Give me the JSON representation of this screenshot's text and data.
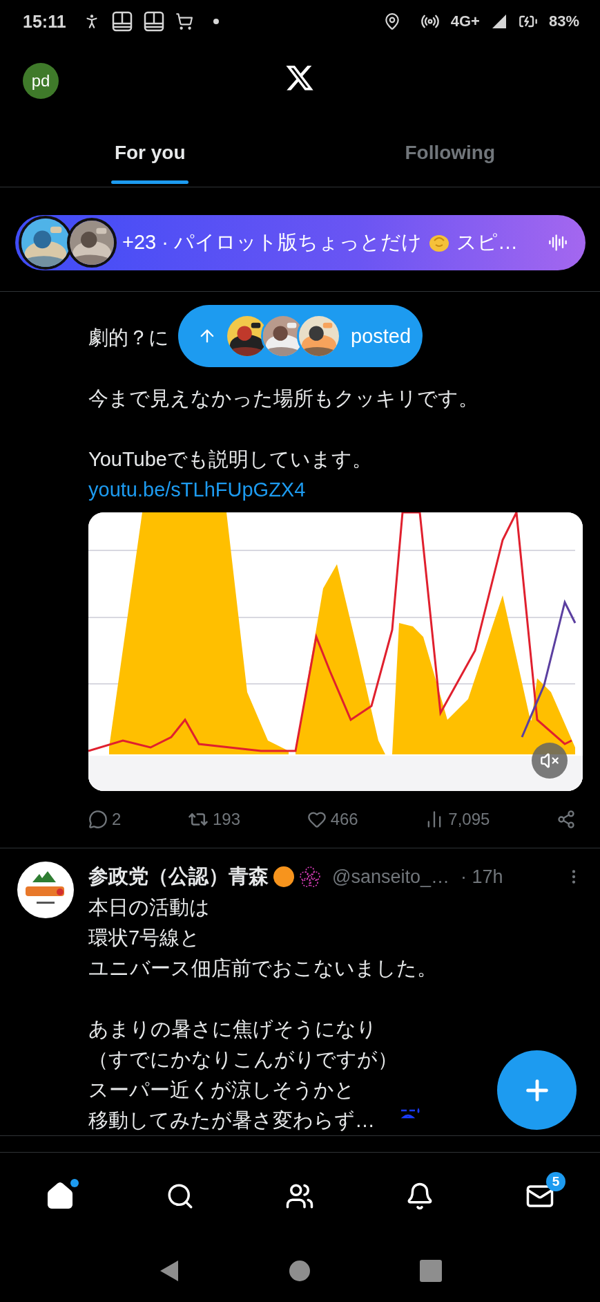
{
  "status_bar": {
    "time": "15:11",
    "network": "4G+",
    "battery": "83%"
  },
  "header": {
    "avatar": "pd"
  },
  "tabs": [
    {
      "label": "For you",
      "selected": true
    },
    {
      "label": "Following",
      "selected": false
    }
  ],
  "space_banner": {
    "text": "+23 · パイロット版ちょっとだけ",
    "text_end": "スピ…"
  },
  "posted_pill": {
    "label": "posted"
  },
  "tweets": [
    {
      "paragraphs": [
        [
          "劇的？に"
        ],
        [
          "今まで見えなかった場所もクッキリです。"
        ],
        [
          "YouTubeでも説明しています。"
        ]
      ],
      "link": "youtu.be/sTLhFUpGZX4",
      "media": {
        "kind": "picture",
        "muted": true
      },
      "stats": {
        "replies": "2",
        "reposts": "193",
        "likes": "466",
        "views": "7,095"
      }
    },
    {
      "author": {
        "name": "参政党（公認）青森",
        "handle": "@sanseito_…",
        "time": "· 17h"
      },
      "paragraphs": [
        [
          "本日の活動は",
          "環状7号線と",
          "ユニバース佃店前でおこないました。"
        ],
        [
          "あまりの暑さに焦げそうになり",
          "（すでにかなりこんがりですが）",
          "スーパー近くが涼しそうかと",
          "移動してみたが暑さ変わらず…"
        ]
      ]
    }
  ],
  "nav": [
    {
      "kind": "home",
      "selected": true,
      "dot": true
    },
    {
      "kind": "search",
      "selected": false,
      "dot": false
    },
    {
      "kind": "communities",
      "selected": false,
      "dot": false
    },
    {
      "kind": "notifications",
      "selected": false,
      "dot": false
    },
    {
      "kind": "messages",
      "selected": false,
      "dot": false,
      "badge": "5"
    }
  ]
}
